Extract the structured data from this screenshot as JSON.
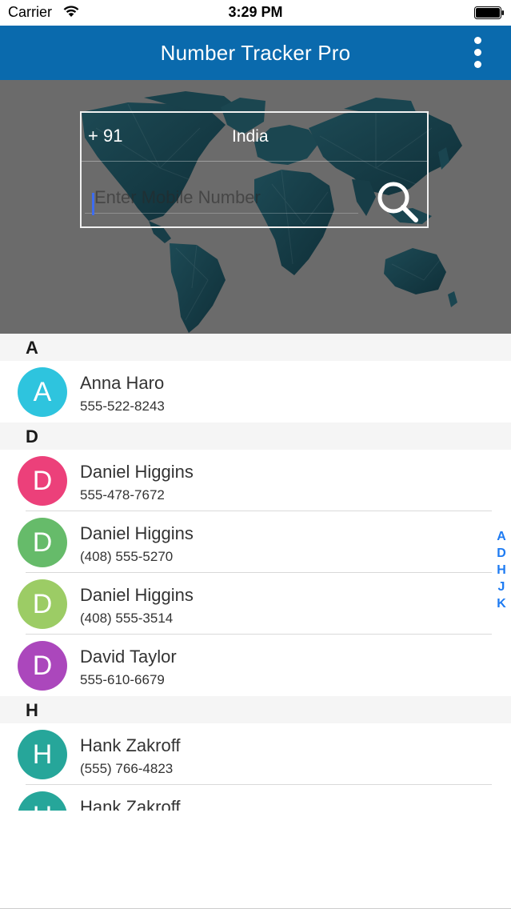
{
  "status_bar": {
    "carrier": "Carrier",
    "time": "3:29 PM",
    "wifi_icon": "wifi-icon",
    "battery_icon": "battery-icon"
  },
  "nav": {
    "title": "Number Tracker Pro",
    "menu_icon": "more-vertical-icon"
  },
  "search": {
    "country_code": "+ 91",
    "country_name": "India",
    "mobile_placeholder": "Enter Mobile Number",
    "mobile_value": "",
    "search_icon": "search-icon"
  },
  "sections": [
    {
      "letter": "A",
      "contacts": [
        {
          "initial": "A",
          "name": "Anna Haro",
          "phone": "555-522-8243",
          "color": "#2ec4de"
        }
      ]
    },
    {
      "letter": "D",
      "contacts": [
        {
          "initial": "D",
          "name": "Daniel Higgins",
          "phone": "555-478-7672",
          "color": "#ec407a"
        },
        {
          "initial": "D",
          "name": "Daniel Higgins",
          "phone": "(408) 555-5270",
          "color": "#66bb6a"
        },
        {
          "initial": "D",
          "name": "Daniel Higgins",
          "phone": "(408) 555-3514",
          "color": "#9ccc65"
        },
        {
          "initial": "D",
          "name": "David Taylor",
          "phone": "555-610-6679",
          "color": "#ab47bc"
        }
      ]
    },
    {
      "letter": "H",
      "contacts": [
        {
          "initial": "H",
          "name": "Hank Zakroff",
          "phone": "(555) 766-4823",
          "color": "#26a69a"
        },
        {
          "initial": "H",
          "name": "Hank Zakroff",
          "phone": "",
          "color": "#26a69a"
        }
      ]
    }
  ],
  "index_letters": [
    "A",
    "D",
    "H",
    "J",
    "K"
  ],
  "colors": {
    "nav_bar": "#0a6aad",
    "hero_bg": "#6b6b6b",
    "index_link": "#1e7bf2",
    "section_bg": "#f5f5f5"
  }
}
